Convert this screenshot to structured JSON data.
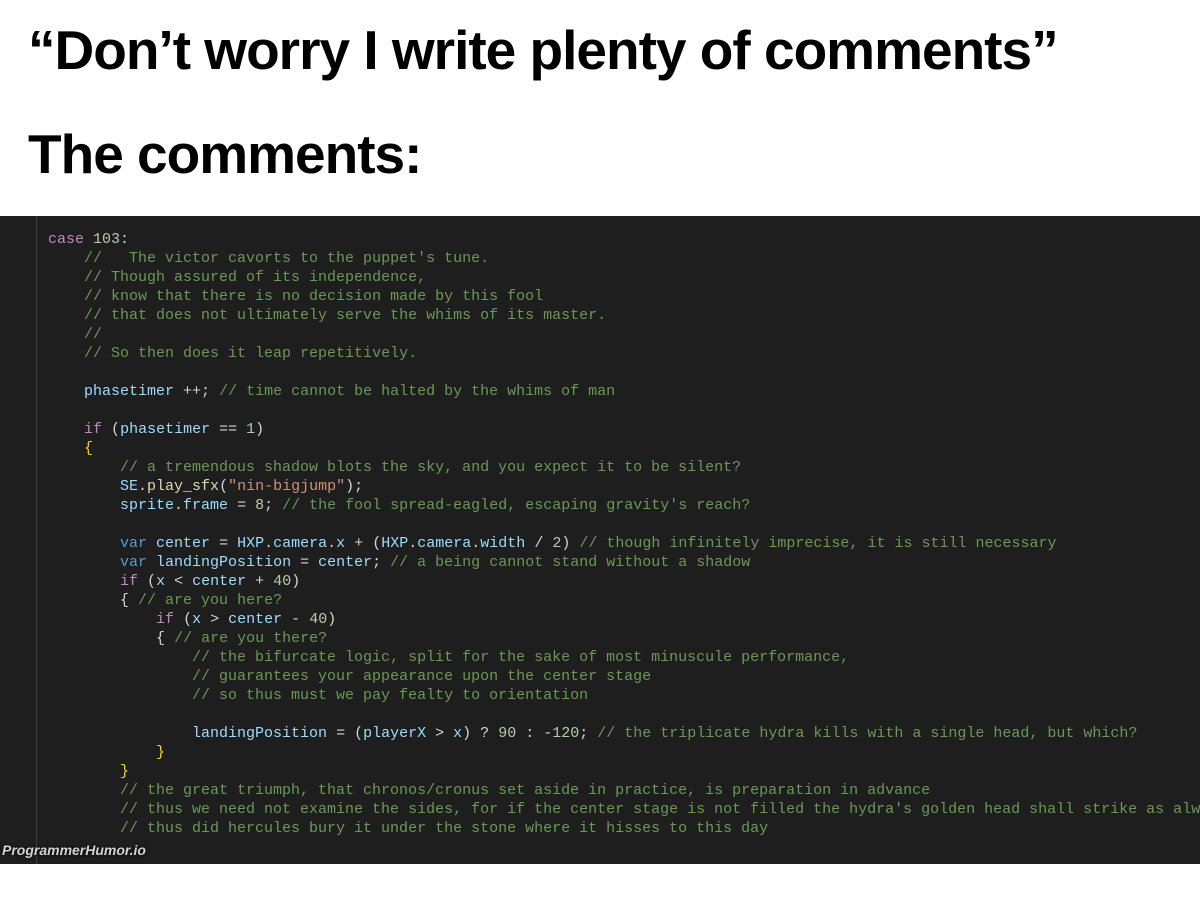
{
  "header": {
    "line1": "“Don’t worry I write plenty of comments”",
    "line2": "The comments:"
  },
  "watermark": "ProgrammerHumor.io",
  "code": {
    "t": {
      "case": "case",
      "if": "if",
      "var": "var",
      "n103": "103",
      "n1": "1",
      "n8": "8",
      "n2": "2",
      "n40a": "40",
      "n40b": "40",
      "n90": "90",
      "n120": "120",
      "id_phasetimer": "phasetimer",
      "id_SE": "SE",
      "id_play_sfx": "play_sfx",
      "id_sprite": "sprite",
      "id_frame": "frame",
      "id_center": "center",
      "id_HXP": "HXP",
      "id_camera": "camera",
      "id_x": "x",
      "id_width": "width",
      "id_landingPosition": "landingPosition",
      "id_playerX": "playerX",
      "str_bigjump": "\"nin-bigjump\""
    },
    "comments": {
      "c1": "//   The victor cavorts to the puppet's tune.",
      "c2": "// Though assured of its independence,",
      "c3": "// know that there is no decision made by this fool",
      "c4": "// that does not ultimately serve the whims of its master.",
      "c5": "//",
      "c6": "// So then does it leap repetitively.",
      "c7": "// time cannot be halted by the whims of man",
      "c8": "// a tremendous shadow blots the sky, and you expect it to be silent?",
      "c9": "// the fool spread-eagled, escaping gravity's reach?",
      "c10": "// though infinitely imprecise, it is still necessary",
      "c11": "// a being cannot stand without a shadow",
      "c12": "// are you here?",
      "c13": "// are you there?",
      "c14": "// the bifurcate logic, split for the sake of most minuscule performance,",
      "c15": "// guarantees your appearance upon the center stage",
      "c16": "// so thus must we pay fealty to orientation",
      "c17": "// the triplicate hydra kills with a single head, but which?",
      "c18": "// the great triumph, that chronos/cronus set aside in practice, is preparation in advance",
      "c19": "// thus we need not examine the sides, for if the center stage is not filled the hydra's golden head shall strike as always",
      "c20": "// thus did hercules bury it under the stone where it hisses to this day"
    }
  }
}
